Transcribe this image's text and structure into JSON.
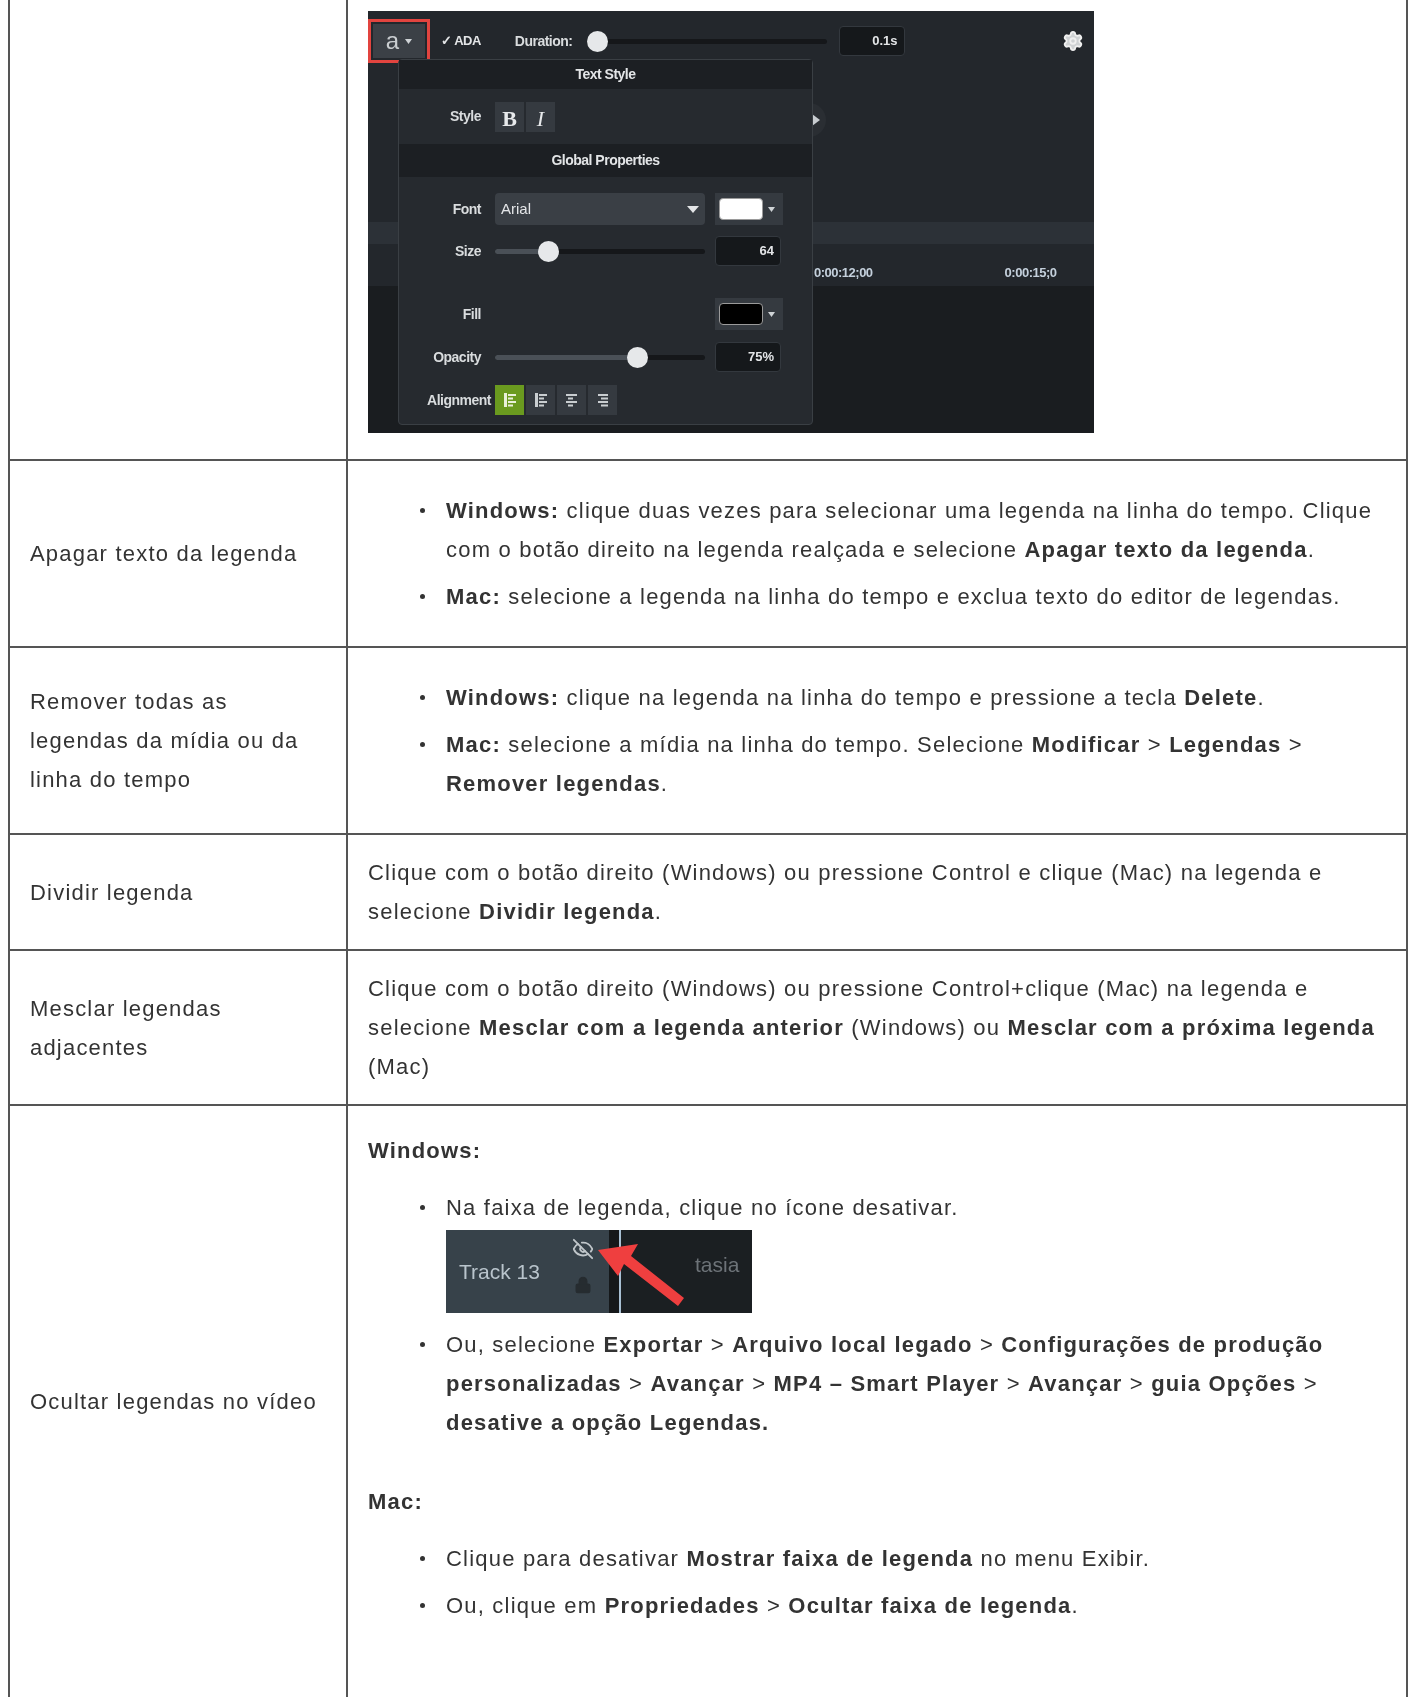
{
  "table": {
    "rows": [
      {
        "kind": "screenshot",
        "screenshot": {
          "toolbar": {
            "font_button": "a",
            "ada": "✓ ADA",
            "duration_label": "Duration:",
            "duration": {
              "level": 0
            },
            "duration_value": "0.1s"
          },
          "popup": {
            "title": "Text Style",
            "style_label": "Style",
            "bold": "B",
            "italic": "I",
            "section": "Global Properties",
            "font_label": "Font",
            "font_value": "Arial",
            "size_label": "Size",
            "size": {
              "level": 0.23
            },
            "size_value": "64",
            "fill_label": "Fill",
            "opacity_label": "Opacity",
            "opacity": {
              "level": 0.7
            },
            "opacity_value": "75%",
            "alignment_label": "Alignment",
            "alignments": [
              {
                "kind": "left",
                "selected": true
              },
              {
                "kind": "left",
                "selected": false
              },
              {
                "kind": "center",
                "selected": false
              },
              {
                "kind": "right",
                "selected": false
              }
            ]
          },
          "timeline": {
            "labels": [
              "0:00:12;00",
              "0:00:15;0"
            ]
          }
        }
      },
      {
        "kind": "bullets",
        "action": "Apagar texto da legenda",
        "items": [
          {
            "text": "**Windows:** clique duas vezes para selecionar uma legenda na linha do tempo. Clique com o botão direito na legenda realçada e selecione **Apagar texto da legenda**."
          },
          {
            "text": "**Mac:** selecione a legenda na linha do tempo e exclua texto do editor de legendas."
          }
        ]
      },
      {
        "kind": "bullets",
        "action": "Remover todas as legendas da mídia ou da linha do tempo",
        "items": [
          {
            "text": "**Windows:** clique na legenda na linha do tempo e pressione a tecla **Delete**."
          },
          {
            "text": "**Mac:** selecione a mídia na linha do tempo. Selecione **Modificar** > **Legendas** > **Remover legendas**."
          }
        ]
      },
      {
        "kind": "paragraph",
        "action": "Dividir legenda",
        "text": "Clique com o botão direito (Windows) ou pressione Control e clique (Mac) na legenda e selecione **Dividir legenda**."
      },
      {
        "kind": "paragraph",
        "action": "Mesclar legendas adjacentes",
        "text": "Clique com o botão direito (Windows) ou pressione Control+clique (Mac) na legenda e selecione **Mesclar com a legenda anterior** (Windows) ou **Mesclar com a próxima legenda** (Mac)"
      },
      {
        "kind": "sections",
        "action": "Ocultar legendas no vídeo",
        "sections": [
          {
            "heading": "Windows:",
            "items": [
              {
                "text": "Na faixa de legenda, clique no ícone desativar.",
                "track": {
                  "name": "Track 13",
                  "clip": "tasia"
                }
              },
              {
                "text": "Ou, selecione **Exportar** > **Arquivo local legado** > **Configurações de produção personalizadas** > **Avançar** > **MP4 – Smart Player** > **Avançar** > **guia Opções** > **desative a opção Legendas.**"
              }
            ]
          },
          {
            "heading": "Mac:",
            "items": [
              {
                "text": "Clique para desativar **Mostrar faixa de legenda** no menu Exibir."
              },
              {
                "text": "Ou, clique em **Propriedades** > **Ocultar faixa de legenda**."
              }
            ]
          }
        ]
      }
    ]
  }
}
